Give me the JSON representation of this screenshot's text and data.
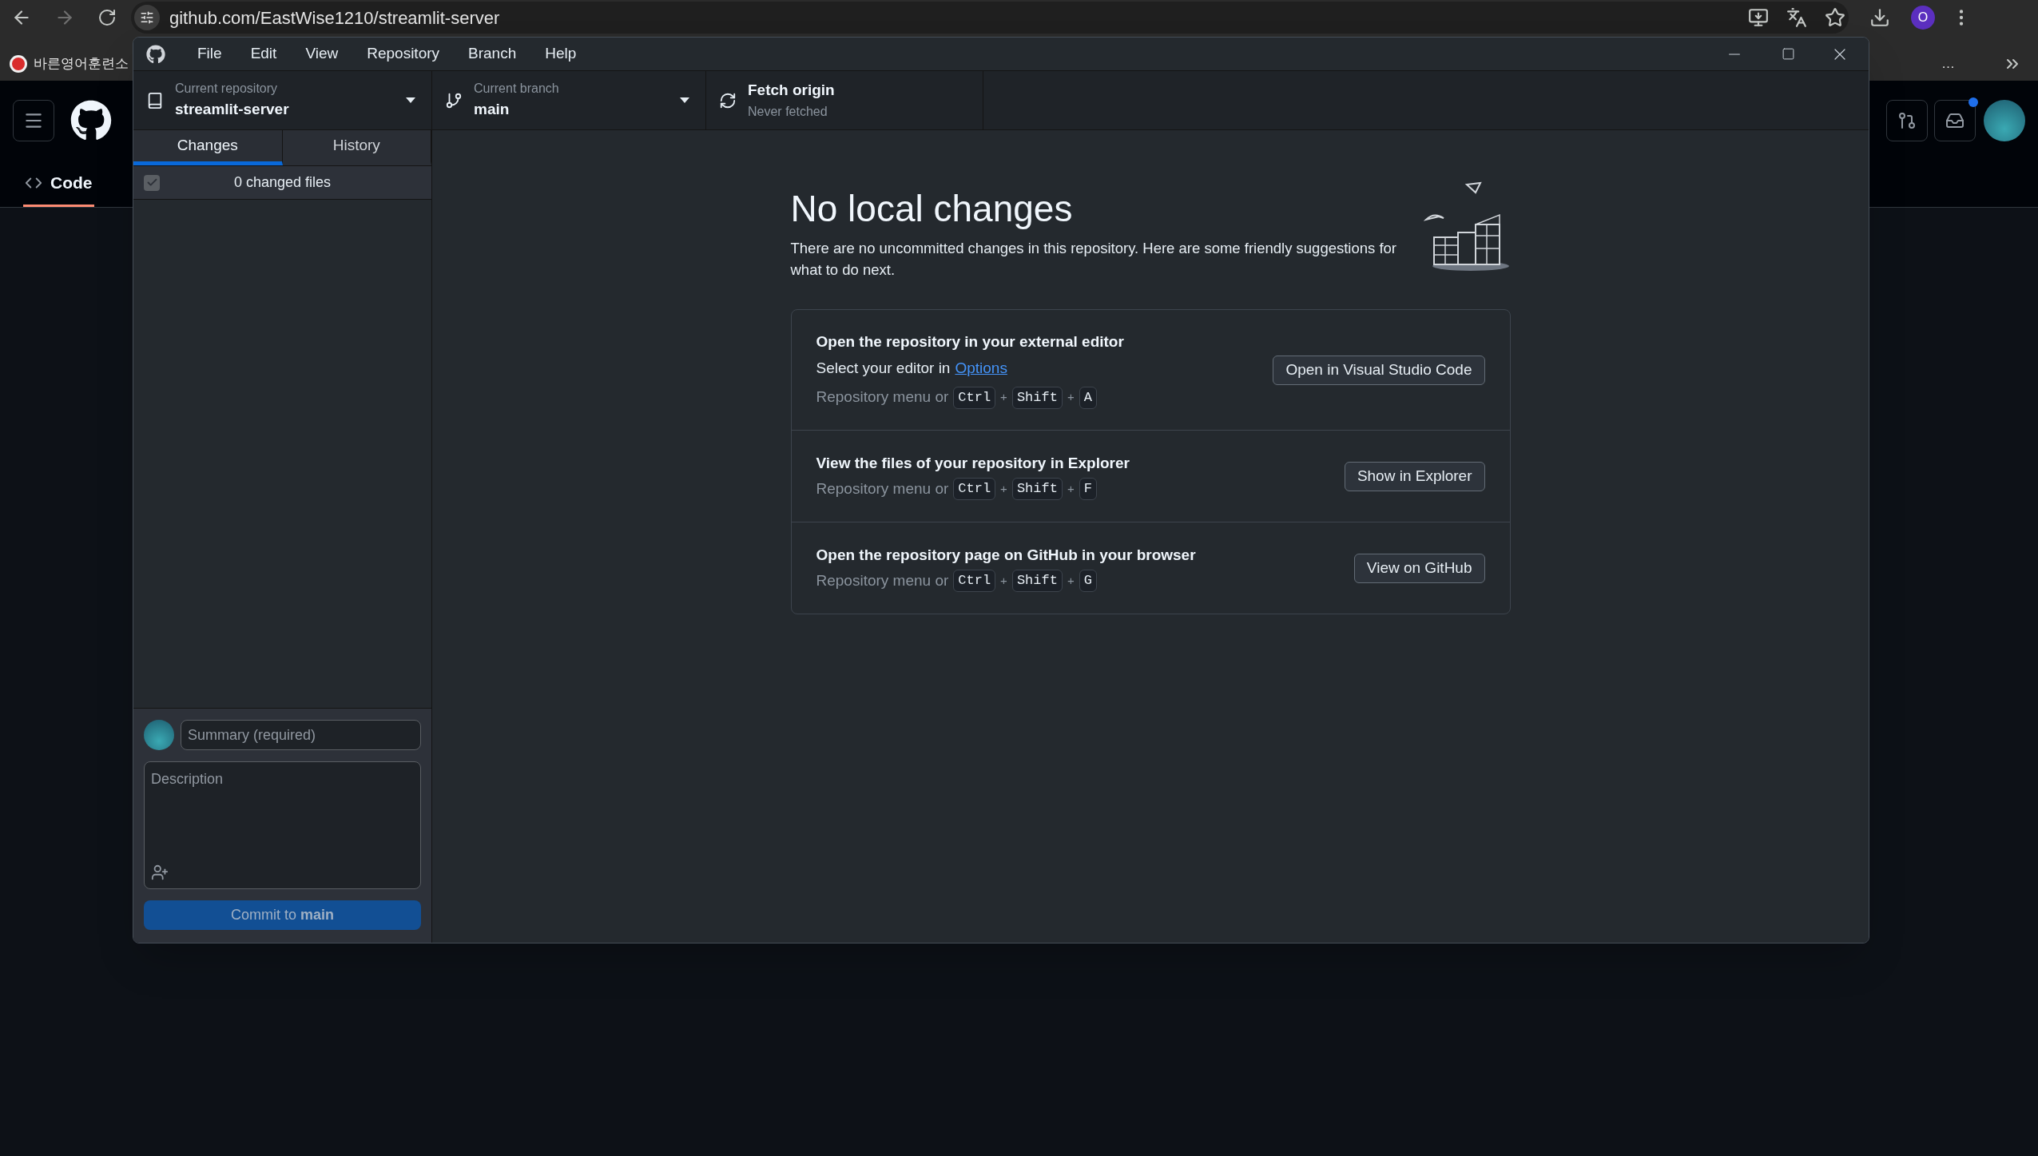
{
  "browser": {
    "url": "github.com/EastWise1210/streamlit-server",
    "profile_initial": "O",
    "bookmarks": [
      {
        "label": "바른영어훈련소"
      },
      {
        "label": "…"
      }
    ]
  },
  "github_page": {
    "tabs": [
      {
        "label": "Code",
        "selected": true
      }
    ],
    "inbox_unread": true
  },
  "app": {
    "menu": [
      "File",
      "Edit",
      "View",
      "Repository",
      "Branch",
      "Help"
    ],
    "toolbar": {
      "repository": {
        "label": "Current repository",
        "value": "streamlit-server"
      },
      "branch": {
        "label": "Current branch",
        "value": "main"
      },
      "fetch": {
        "title": "Fetch origin",
        "subtitle": "Never fetched"
      }
    },
    "sidebar_tabs": [
      {
        "label": "Changes",
        "selected": true
      },
      {
        "label": "History",
        "selected": false
      }
    ],
    "changed_files": {
      "label": "0 changed files",
      "checked": true
    },
    "commit": {
      "summary_placeholder": "Summary (required)",
      "description_placeholder": "Description",
      "button": "Commit to **main**",
      "disabled": true
    },
    "main": {
      "title": "No local changes",
      "description": "There are no uncommitted changes in this repository. Here are some friendly suggestions for what to do next.",
      "suggestions": [
        {
          "title": "Open the repository in your external editor",
          "detail": "Select your editor in",
          "link": "Options",
          "shortcut_prefix": "Repository menu or",
          "shortcut": [
            {
              "kind": "key",
              "text": "Ctrl"
            },
            {
              "kind": "plus",
              "text": "+"
            },
            {
              "kind": "key",
              "text": "Shift"
            },
            {
              "kind": "plus",
              "text": "+"
            },
            {
              "kind": "key",
              "text": "A"
            }
          ],
          "button": "Open in Visual Studio Code"
        },
        {
          "title": "View the files of your repository in Explorer",
          "shortcut_prefix": "Repository menu or",
          "shortcut": [
            {
              "kind": "key",
              "text": "Ctrl"
            },
            {
              "kind": "plus",
              "text": "+"
            },
            {
              "kind": "key",
              "text": "Shift"
            },
            {
              "kind": "plus",
              "text": "+"
            },
            {
              "kind": "key",
              "text": "F"
            }
          ],
          "button": "Show in Explorer"
        },
        {
          "title": "Open the repository page on GitHub in your browser",
          "shortcut_prefix": "Repository menu or",
          "shortcut": [
            {
              "kind": "key",
              "text": "Ctrl"
            },
            {
              "kind": "plus",
              "text": "+"
            },
            {
              "kind": "key",
              "text": "Shift"
            },
            {
              "kind": "plus",
              "text": "+"
            },
            {
              "kind": "key",
              "text": "G"
            }
          ],
          "button": "View on GitHub"
        }
      ]
    }
  }
}
